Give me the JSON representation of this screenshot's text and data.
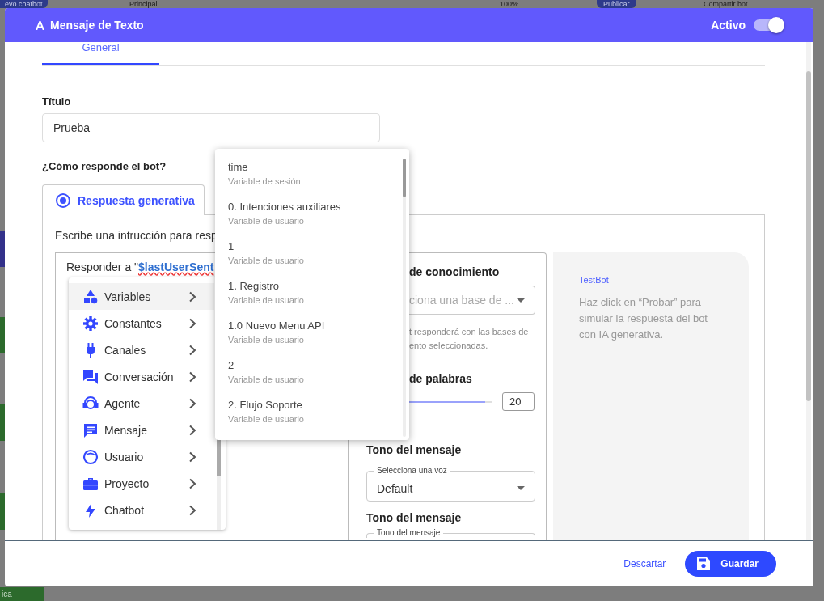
{
  "background_app": {
    "toolbar": [
      "evo chatbot",
      "Principal",
      "100%",
      "Publicar",
      "Compartir bot"
    ],
    "sidebar_label": "ica"
  },
  "modal": {
    "title": "Mensaje de Texto",
    "active": {
      "label": "Activo",
      "on": true
    },
    "tabs": [
      {
        "label": "General",
        "selected": true
      }
    ],
    "title_field": {
      "label": "Título",
      "value": "Prueba"
    },
    "question": "¿Cómo responde el bot?",
    "response_tabs": [
      {
        "label": "Respuesta generativa",
        "selected": true
      }
    ],
    "instruction_label": "Escribe una intrucción para resp",
    "instruction": {
      "prefix": "Responder a \"",
      "variable": "$lastUserSent"
    },
    "insert_menu": [
      {
        "label": "Variables",
        "kind": "shapes",
        "selected": true
      },
      {
        "label": "Constantes",
        "kind": "gear",
        "selected": false
      },
      {
        "label": "Canales",
        "kind": "plug",
        "selected": false
      },
      {
        "label": "Conversación",
        "kind": "chat",
        "selected": false
      },
      {
        "label": "Agente",
        "kind": "headset",
        "selected": false
      },
      {
        "label": "Mensaje",
        "kind": "message",
        "selected": false
      },
      {
        "label": "Usuario",
        "kind": "face",
        "selected": false
      },
      {
        "label": "Proyecto",
        "kind": "briefcase",
        "selected": false
      },
      {
        "label": "Chatbot",
        "kind": "bolt",
        "selected": false
      }
    ],
    "variables_dropdown": [
      {
        "name": "time",
        "type": "Variable de sesión"
      },
      {
        "name": "0. Intenciones auxiliares",
        "type": "Variable de usuario"
      },
      {
        "name": "1",
        "type": "Variable de usuario"
      },
      {
        "name": "1. Registro",
        "type": "Variable de usuario"
      },
      {
        "name": "1.0 Nuevo Menu API",
        "type": "Variable de usuario"
      },
      {
        "name": "2",
        "type": "Variable de usuario"
      },
      {
        "name": "2. Flujo Soporte",
        "type": "Variable de usuario"
      }
    ],
    "settings": {
      "knowledge_label": "de conocimiento",
      "knowledge_placeholder": "ciona una base de ...",
      "knowledge_help": [
        "t responderá con las bases de",
        "ento seleccionadas."
      ],
      "words_label": "de palabras",
      "word_slider": {
        "level": 0.95
      },
      "words_value": "20",
      "voice_label": "Tono del mensaje",
      "voice_legend": "Selecciona una voz",
      "voice_value": "Default",
      "tone_label": "Tono del mensaje",
      "tone_legend": "Tono del mensaje"
    },
    "preview": {
      "title": "TestBot",
      "text": "Haz click en “Probar” para simular la respuesta del bot con IA generativa."
    },
    "footer": {
      "discard": "Descartar",
      "save": "Guardar"
    }
  }
}
